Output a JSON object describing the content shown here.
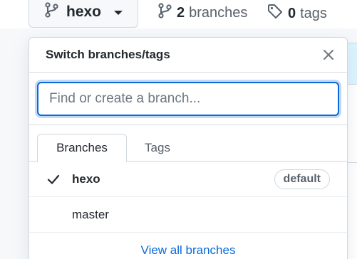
{
  "branch_button": {
    "current": "hexo"
  },
  "counters": {
    "branches": {
      "count": "2",
      "label": "branches"
    },
    "tags": {
      "count": "0",
      "label": "tags"
    }
  },
  "panel": {
    "title": "Switch branches/tags",
    "filter": {
      "placeholder": "Find or create a branch...",
      "value": ""
    },
    "tabs": [
      {
        "label": "Branches",
        "active": true
      },
      {
        "label": "Tags",
        "active": false
      }
    ],
    "branches": [
      {
        "name": "hexo",
        "selected": true,
        "badge": "default"
      },
      {
        "name": "master",
        "selected": false,
        "badge": ""
      }
    ],
    "footer_link": "View all branches"
  },
  "colors": {
    "accent": "#0969da",
    "border": "#d0d7de",
    "muted": "#57606a",
    "text": "#24292f"
  }
}
